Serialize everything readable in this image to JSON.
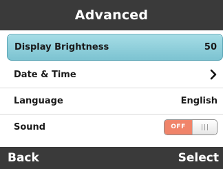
{
  "header": {
    "title": "Advanced"
  },
  "menu": {
    "items": [
      {
        "label": "Display Brightness",
        "value": "50"
      },
      {
        "label": "Date & Time",
        "icon": "chevron-right-icon"
      },
      {
        "label": "Language",
        "value": "English"
      },
      {
        "label": "Sound",
        "toggle_label": "OFF"
      }
    ]
  },
  "footer": {
    "left": "Back",
    "right": "Select"
  },
  "colors": {
    "bar": "#3a3a3a",
    "selection": "#8fd0dc",
    "toggle_off": "#f0846a"
  }
}
